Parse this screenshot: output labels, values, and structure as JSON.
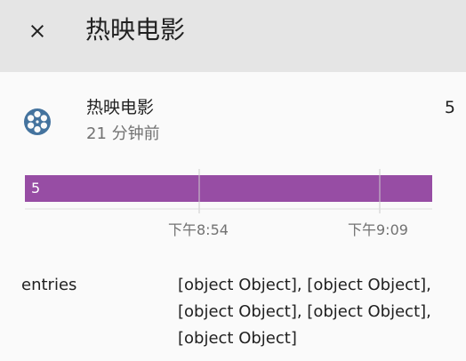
{
  "dialog": {
    "title": "热映电影",
    "close_icon": "close-icon"
  },
  "entity": {
    "icon": "film-reel-icon",
    "icon_color": "#44739e",
    "name": "热映电影",
    "last_changed": "21 分钟前",
    "state": "5"
  },
  "history": {
    "bar_color": "#974da4",
    "bar_label": "5",
    "ticks": [
      "下午8:54",
      "下午9:09"
    ]
  },
  "attributes": [
    {
      "key": "entries",
      "value": "[object Object], [object Object], [object Object], [object Object], [object Object]"
    }
  ]
}
